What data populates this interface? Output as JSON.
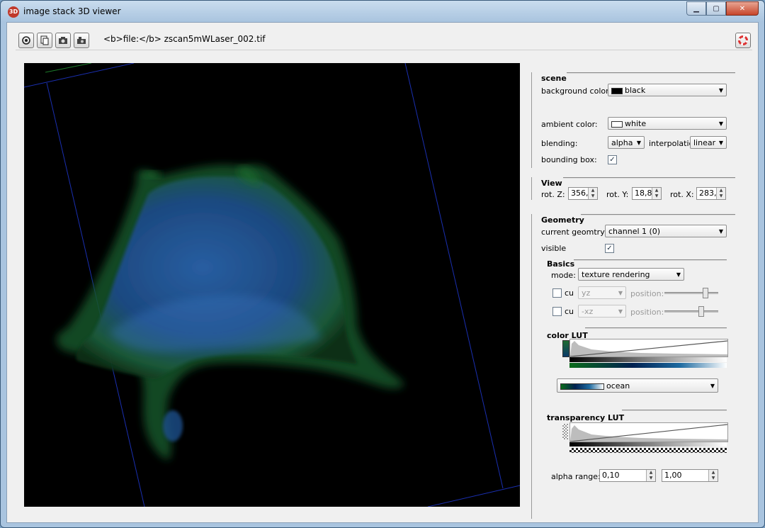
{
  "window": {
    "title": "image stack 3D viewer",
    "app_icon_text": "3D",
    "buttons": {
      "minimize": "▁",
      "maximize": "▢",
      "close": "✕"
    }
  },
  "toolbar": {
    "file_label": "<b>file:</b> zscan5mWLaser_002.tif",
    "buttons": [
      "power-icon",
      "copy-icon",
      "save-snapshot-icon",
      "camera-icon"
    ],
    "help_icon": "lifebuoy-icon"
  },
  "scene": {
    "title": "scene",
    "background_label": "background color:",
    "background_value": "black",
    "ambient_label": "ambient color:",
    "ambient_value": "white",
    "blending_label": "blending:",
    "blending_value": "alpha",
    "interpolation_label": "interpolatic",
    "interpolation_value": "linear",
    "bounding_label": "bounding box:",
    "bounding_checked": true
  },
  "view": {
    "title": "View",
    "rotz_label": "rot. Z:",
    "rotz_value": "356,",
    "roty_label": "rot. Y:",
    "roty_value": "18,8",
    "rotx_label": "rot. X:",
    "rotx_value": "283,"
  },
  "geometry": {
    "title": "Geometry",
    "current_label": "current geomtry:",
    "current_value": "channel 1 (0)",
    "visible_label": "visible",
    "visible_checked": true,
    "basics_title": "Basics",
    "mode_label": "mode:",
    "mode_value": "texture rendering",
    "cut1_label": "cu",
    "cut1_plane": "yz",
    "cut1_pos_label": "position:",
    "cut1_level": 0.75,
    "cut2_label": "cu",
    "cut2_plane": "-xz",
    "cut2_pos_label": "position:",
    "cut2_level": 0.67,
    "color_lut_title": "color LUT",
    "color_lut_value": "ocean",
    "transparency_lut_title": "transparency LUT",
    "alpha_range_label": "alpha range:",
    "alpha_min": "0,10",
    "alpha_max": "1,00"
  },
  "colors": {
    "viewport_bg": "#000000",
    "volume_green": "#1f7a2a",
    "volume_blue": "#1e4f8c",
    "bbox_blue": "#1a2fb0"
  }
}
